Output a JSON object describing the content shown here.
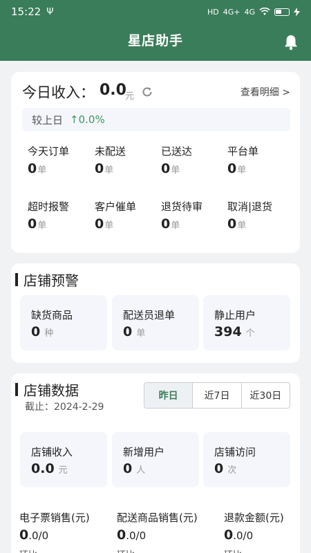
{
  "status_bar": {
    "time": "15:22",
    "usb": "Ψ",
    "network_label_1": "4G+",
    "network_label_2": "4G",
    "hd_label": "HD"
  },
  "header": {
    "title": "星店助手"
  },
  "today": {
    "label": "今日收入：",
    "value": "0.0",
    "unit": "元",
    "detail_link": "查看明细 >",
    "compare_label": "较上日",
    "compare_value": "↑0.0%",
    "stats": [
      {
        "label": "今天订单",
        "value": "0",
        "unit": "单"
      },
      {
        "label": "未配送",
        "value": "0",
        "unit": "单"
      },
      {
        "label": "已送达",
        "value": "0",
        "unit": "单"
      },
      {
        "label": "平台单",
        "value": "0",
        "unit": "单"
      },
      {
        "label": "超时报警",
        "value": "0",
        "unit": "单"
      },
      {
        "label": "客户催单",
        "value": "0",
        "unit": "单"
      },
      {
        "label": "退货待审",
        "value": "0",
        "unit": "单"
      },
      {
        "label": "取消|退货",
        "value": "0",
        "unit": "单"
      }
    ]
  },
  "warning": {
    "title": "店铺预警",
    "tiles": [
      {
        "label": "缺货商品",
        "value": "0",
        "unit": "种"
      },
      {
        "label": "配送员退单",
        "value": "0",
        "unit": "单"
      },
      {
        "label": "静止用户",
        "value": "394",
        "unit": "个"
      }
    ]
  },
  "store_data": {
    "title": "店铺数据",
    "deadline": "截止：2024-2-29",
    "tabs": [
      {
        "label": "昨日",
        "active": true
      },
      {
        "label": "近7日",
        "active": false
      },
      {
        "label": "近30日",
        "active": false
      }
    ],
    "tiles": [
      {
        "label": "店铺收入",
        "value": "0.0",
        "unit": "元"
      },
      {
        "label": "新增用户",
        "value": "0",
        "unit": "人"
      },
      {
        "label": "店铺访问",
        "value": "0",
        "unit": "次"
      }
    ],
    "bottom_stats": [
      {
        "label": "电子票销售(元)",
        "value_big": "0",
        "value_small": ".0/0"
      },
      {
        "label": "配送商品销售(元)",
        "value_big": "0",
        "value_small": ".0/0"
      },
      {
        "label": "退款金额(元)",
        "value_big": "0",
        "value_small": ".0/0"
      }
    ],
    "bottom_cut": [
      "环比",
      "环比",
      "环比"
    ]
  },
  "colors": {
    "brand": "#3a7d5a",
    "positive": "#3a9a5a"
  }
}
